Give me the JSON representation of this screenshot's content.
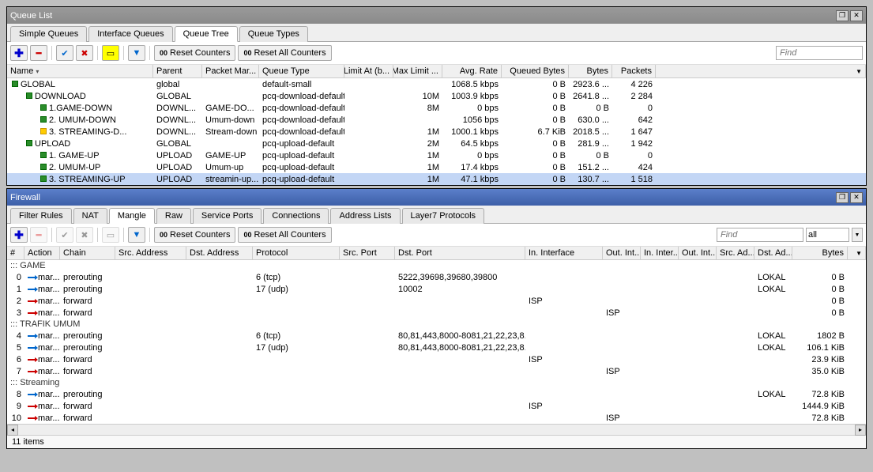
{
  "queue": {
    "title": "Queue List",
    "tabs": [
      "Simple Queues",
      "Interface Queues",
      "Queue Tree",
      "Queue Types"
    ],
    "activeTab": 2,
    "resetCounters": "Reset Counters",
    "resetAll": "Reset All Counters",
    "find": "Find",
    "cols": [
      "Name",
      "Parent",
      "Packet Mar...",
      "Queue Type",
      "Limit At (b...",
      "Max Limit ...",
      "Avg. Rate",
      "Queued Bytes",
      "Bytes",
      "Packets"
    ],
    "rows": [
      {
        "indent": 0,
        "ico": "g",
        "name": "GLOBAL",
        "parent": "global",
        "pm": "",
        "qt": "default-small",
        "la": "",
        "ml": "",
        "ar": "1068.5 kbps",
        "qb": "0 B",
        "by": "2923.6 ...",
        "pk": "4 226"
      },
      {
        "indent": 1,
        "ico": "g",
        "name": "DOWNLOAD",
        "parent": "GLOBAL",
        "pm": "",
        "qt": "pcq-download-default",
        "la": "",
        "ml": "10M",
        "ar": "1003.9 kbps",
        "qb": "0 B",
        "by": "2641.8 ...",
        "pk": "2 284"
      },
      {
        "indent": 2,
        "ico": "g",
        "name": "1.GAME-DOWN",
        "parent": "DOWNL...",
        "pm": "GAME-DO...",
        "qt": "pcq-download-default",
        "la": "",
        "ml": "8M",
        "ar": "0 bps",
        "qb": "0 B",
        "by": "0 B",
        "pk": "0"
      },
      {
        "indent": 2,
        "ico": "g",
        "name": "2. UMUM-DOWN",
        "parent": "DOWNL...",
        "pm": "Umum-down",
        "qt": "pcq-download-default",
        "la": "",
        "ml": "",
        "ar": "1056 bps",
        "qb": "0 B",
        "by": "630.0 ...",
        "pk": "642"
      },
      {
        "indent": 2,
        "ico": "y",
        "name": "3. STREAMING-D...",
        "parent": "DOWNL...",
        "pm": "Stream-down",
        "qt": "pcq-download-default",
        "la": "",
        "ml": "1M",
        "ar": "1000.1 kbps",
        "qb": "6.7 KiB",
        "by": "2018.5 ...",
        "pk": "1 647"
      },
      {
        "indent": 1,
        "ico": "g",
        "name": "UPLOAD",
        "parent": "GLOBAL",
        "pm": "",
        "qt": "pcq-upload-default",
        "la": "",
        "ml": "2M",
        "ar": "64.5 kbps",
        "qb": "0 B",
        "by": "281.9 ...",
        "pk": "1 942"
      },
      {
        "indent": 2,
        "ico": "g",
        "name": "1. GAME-UP",
        "parent": "UPLOAD",
        "pm": "GAME-UP",
        "qt": "pcq-upload-default",
        "la": "",
        "ml": "1M",
        "ar": "0 bps",
        "qb": "0 B",
        "by": "0 B",
        "pk": "0"
      },
      {
        "indent": 2,
        "ico": "g",
        "name": "2. UMUM-UP",
        "parent": "UPLOAD",
        "pm": "Umum-up",
        "qt": "pcq-upload-default",
        "la": "",
        "ml": "1M",
        "ar": "17.4 kbps",
        "qb": "0 B",
        "by": "151.2 ...",
        "pk": "424"
      },
      {
        "indent": 2,
        "ico": "g",
        "name": "3. STREAMING-UP",
        "parent": "UPLOAD",
        "pm": "streamin-up...",
        "qt": "pcq-upload-default",
        "la": "",
        "ml": "1M",
        "ar": "47.1 kbps",
        "qb": "0 B",
        "by": "130.7 ...",
        "pk": "1 518",
        "sel": true
      }
    ]
  },
  "fw": {
    "title": "Firewall",
    "tabs": [
      "Filter Rules",
      "NAT",
      "Mangle",
      "Raw",
      "Service Ports",
      "Connections",
      "Address Lists",
      "Layer7 Protocols"
    ],
    "activeTab": 2,
    "resetCounters": "Reset Counters",
    "resetAll": "Reset All Counters",
    "find": "Find",
    "all": "all",
    "cols": [
      "#",
      "Action",
      "Chain",
      "Src. Address",
      "Dst. Address",
      "Protocol",
      "Src. Port",
      "Dst. Port",
      "In. Interface",
      "Out. Int...",
      "In. Inter...",
      "Out. Int...",
      "Src. Ad...",
      "Dst. Ad...",
      "Bytes"
    ],
    "sections": [
      {
        "label": "::: GAME",
        "rows": [
          {
            "n": "0",
            "c": "b",
            "act": "mar...",
            "chain": "prerouting",
            "proto": "6 (tcp)",
            "dport": "5222,39698,39680,39800",
            "dad": "LOKAL",
            "bytes": "0 B"
          },
          {
            "n": "1",
            "c": "b",
            "act": "mar...",
            "chain": "prerouting",
            "proto": "17 (udp)",
            "dport": "10002",
            "dad": "LOKAL",
            "bytes": "0 B"
          },
          {
            "n": "2",
            "c": "r",
            "act": "mar...",
            "chain": "forward",
            "iin": "ISP",
            "bytes": "0 B"
          },
          {
            "n": "3",
            "c": "r",
            "act": "mar...",
            "chain": "forward",
            "oin": "ISP",
            "bytes": "0 B"
          }
        ]
      },
      {
        "label": "::: TRAFIK UMUM",
        "rows": [
          {
            "n": "4",
            "c": "b",
            "act": "mar...",
            "chain": "prerouting",
            "proto": "6 (tcp)",
            "dport": "80,81,443,8000-8081,21,22,23,8...",
            "dad": "LOKAL",
            "bytes": "1802 B"
          },
          {
            "n": "5",
            "c": "b",
            "act": "mar...",
            "chain": "prerouting",
            "proto": "17 (udp)",
            "dport": "80,81,443,8000-8081,21,22,23,8...",
            "dad": "LOKAL",
            "bytes": "106.1 KiB"
          },
          {
            "n": "6",
            "c": "r",
            "act": "mar...",
            "chain": "forward",
            "iin": "ISP",
            "bytes": "23.9 KiB"
          },
          {
            "n": "7",
            "c": "r",
            "act": "mar...",
            "chain": "forward",
            "oin": "ISP",
            "bytes": "35.0 KiB"
          }
        ]
      },
      {
        "label": "::: Streaming",
        "rows": [
          {
            "n": "8",
            "c": "b",
            "act": "mar...",
            "chain": "prerouting",
            "dad": "LOKAL",
            "bytes": "72.8 KiB"
          },
          {
            "n": "9",
            "c": "r",
            "act": "mar...",
            "chain": "forward",
            "iin": "ISP",
            "bytes": "1444.9 KiB"
          },
          {
            "n": "10",
            "c": "r",
            "act": "mar...",
            "chain": "forward",
            "oin": "ISP",
            "bytes": "72.8 KiB"
          }
        ]
      }
    ],
    "status": "11 items"
  }
}
